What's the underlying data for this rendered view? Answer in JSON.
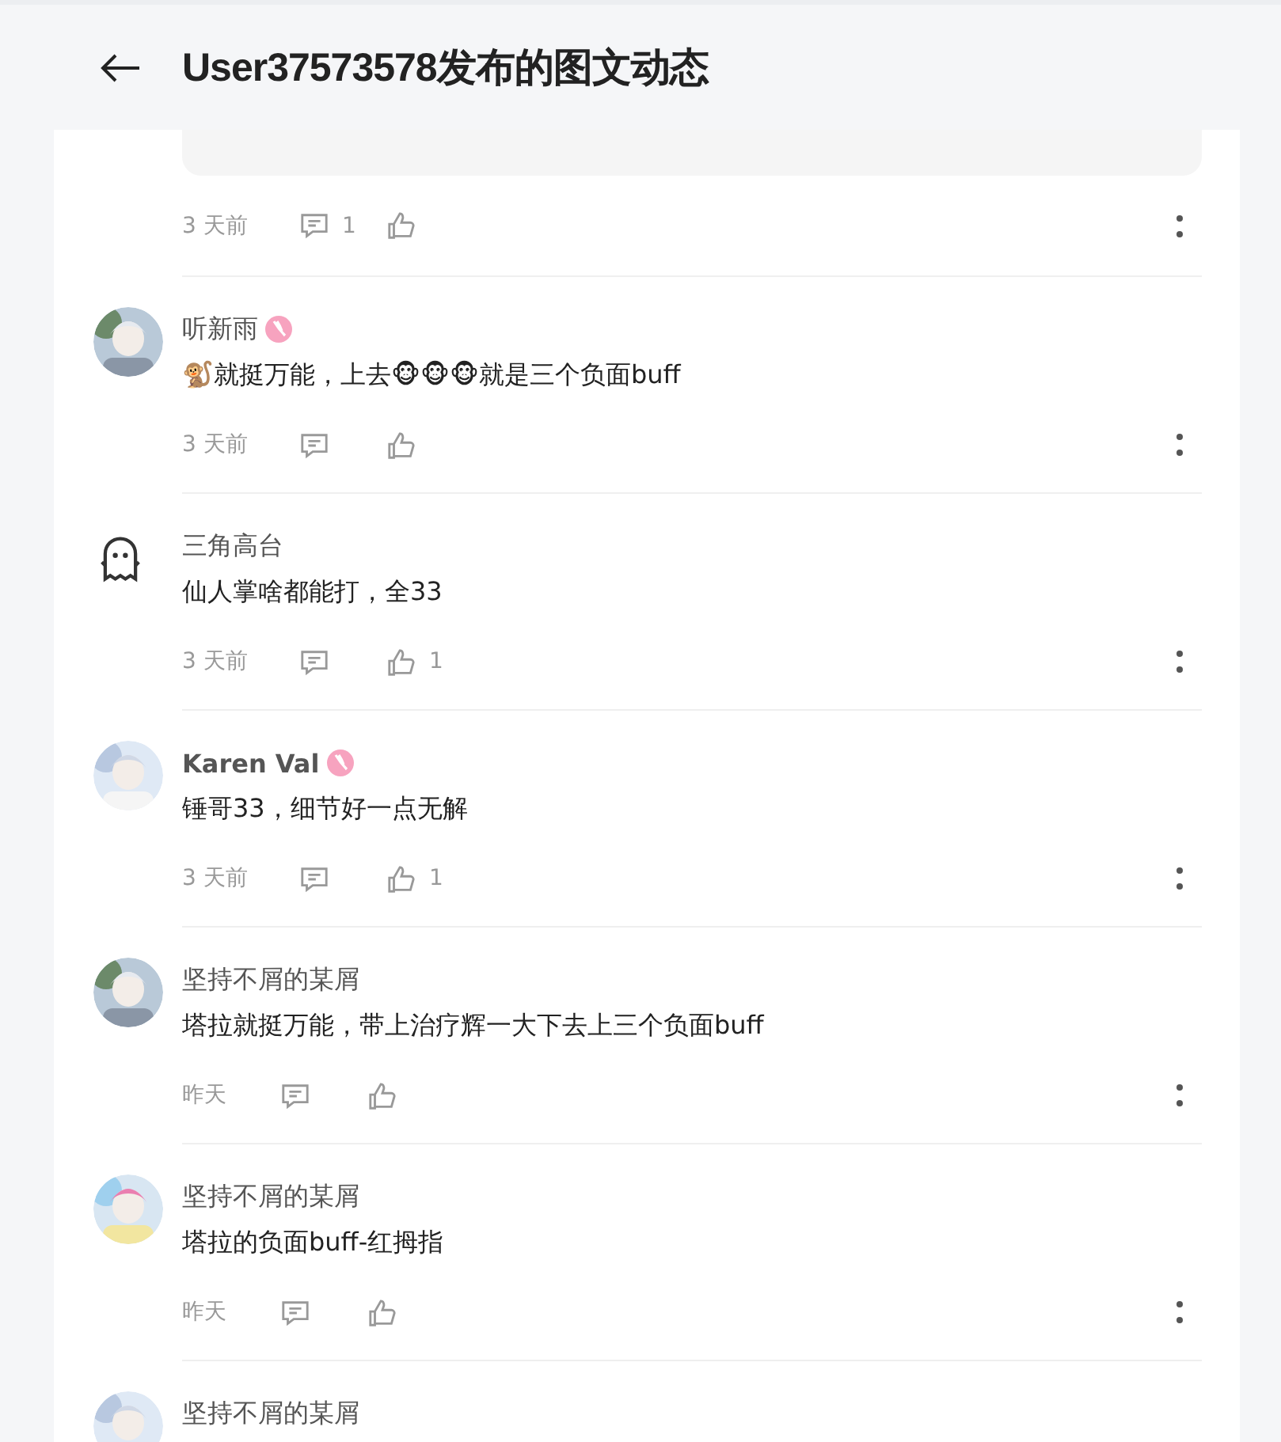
{
  "header": {
    "title": "User37573578发布的图文动态"
  },
  "top_item": {
    "time": "3 天前",
    "comment_count": "1"
  },
  "comments": [
    {
      "kind": "picture",
      "name": "听新雨",
      "badge": true,
      "bold": false,
      "text": "🐒就挺万能，上去🐵🐵🐵就是三个负面buff",
      "time": "3 天前"
    },
    {
      "kind": "ghost",
      "name": "三角高台",
      "badge": false,
      "bold": false,
      "text": "仙人掌啥都能打，全33",
      "time": "3 天前",
      "likes": "1"
    },
    {
      "kind": "picture",
      "name": "Karen Val",
      "badge": true,
      "bold": true,
      "text": "锤哥33，细节好一点无解",
      "time": "3 天前",
      "likes": "1"
    },
    {
      "kind": "picture",
      "name": "坚持不屑的某屑",
      "badge": false,
      "bold": false,
      "text": "塔拉就挺万能，带上治疗辉一大下去上三个负面buff",
      "time": "昨天"
    },
    {
      "kind": "picture",
      "name": "坚持不屑的某屑",
      "badge": false,
      "bold": false,
      "text": "塔拉的负面buff-红拇指",
      "time": "昨天"
    },
    {
      "kind": "picture",
      "name": "坚持不屑的某屑",
      "badge": false,
      "bold": false
    }
  ]
}
